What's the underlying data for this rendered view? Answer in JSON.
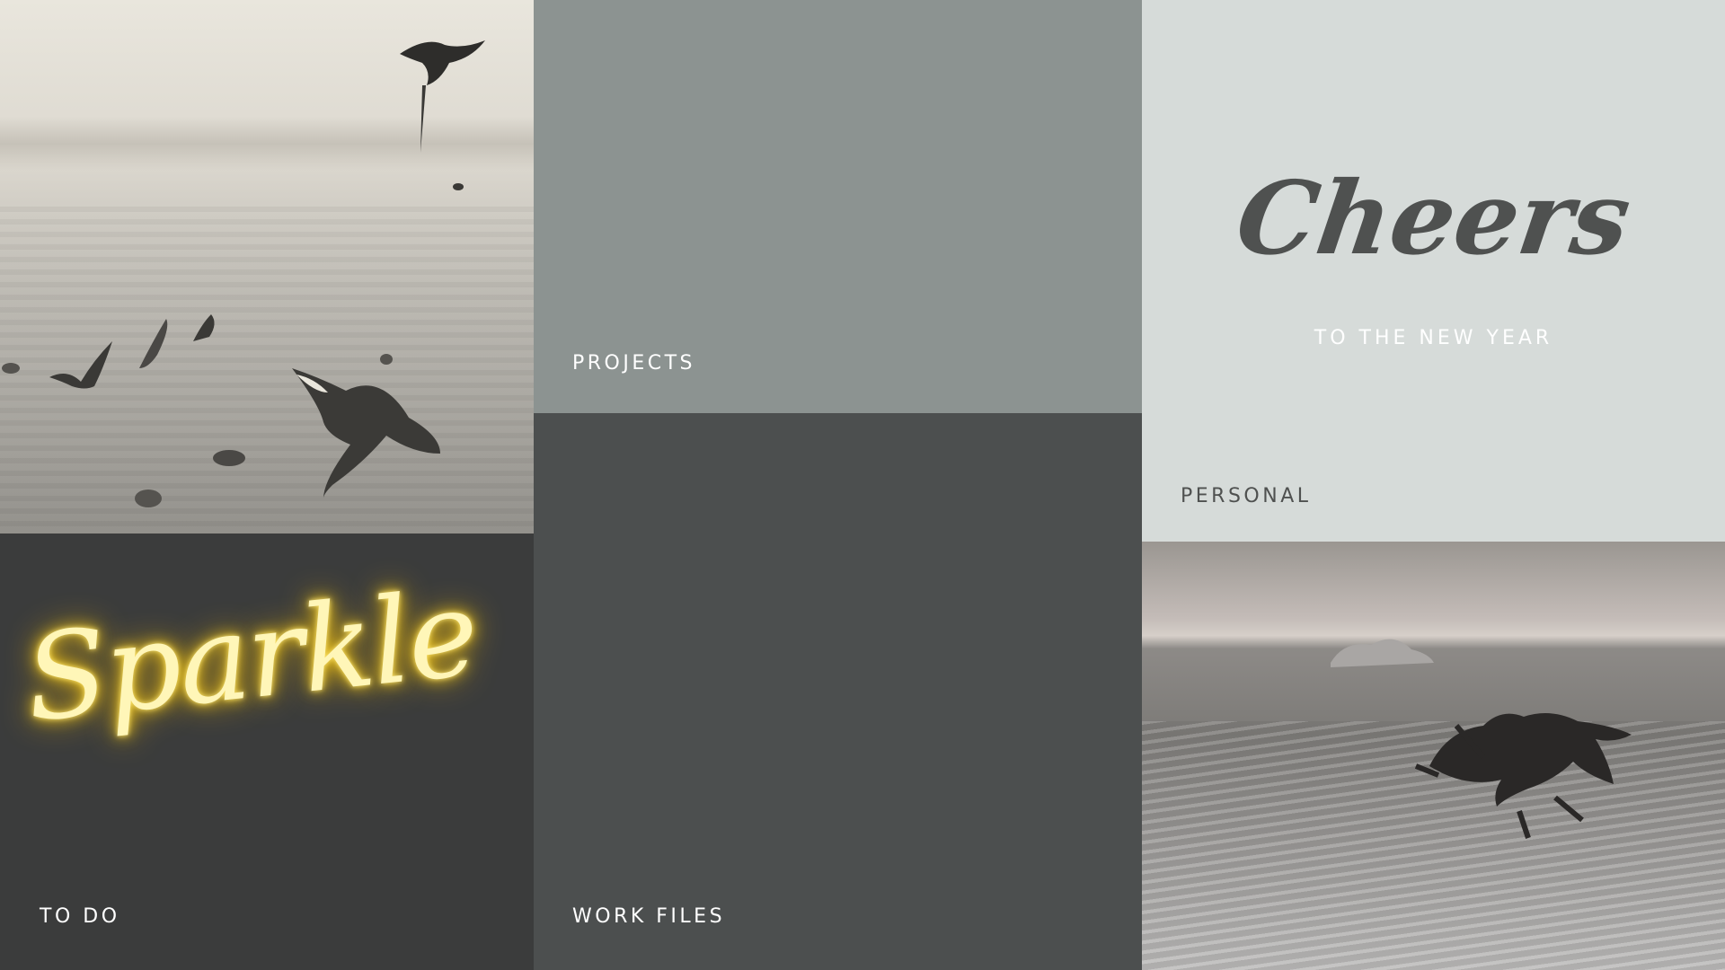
{
  "tiles": {
    "birds": {
      "alt_kind": "photo"
    },
    "todo": {
      "script_text": "Sparkle",
      "label": "TO DO"
    },
    "projects": {
      "label": "PROJECTS"
    },
    "work": {
      "label": "WORK FILES"
    },
    "cheers": {
      "title": "Cheers",
      "subtitle": "TO THE NEW YEAR",
      "label": "PERSONAL"
    },
    "beach": {
      "alt_kind": "photo"
    }
  },
  "colors": {
    "neon_yellow": "#ffd21f",
    "projects_bg": "#8c9391",
    "work_bg": "#4c4f4f",
    "todo_bg": "#3b3c3c",
    "personal_bg": "#d6dbd9",
    "cheers_text": "#4f5150"
  }
}
